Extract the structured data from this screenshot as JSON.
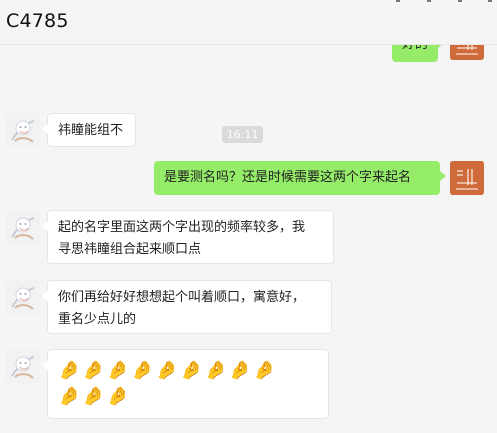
{
  "window": {
    "title": "C4785"
  },
  "partial_top_message": {
    "text": "好的"
  },
  "timestamp": "16:11",
  "messages": [
    {
      "side": "left",
      "text": "祎瞳能组不"
    },
    {
      "side": "right",
      "text": "是要测名吗？还是时候需要这两个字来起名"
    },
    {
      "side": "left",
      "text": "起的名字里面这两个字出现的频率较多，我\n寻思祎瞳组合起来顺口点"
    },
    {
      "side": "left",
      "text": "你们再给好好想想起个叫着顺口，寓意好，\n重名少点儿的"
    },
    {
      "side": "left",
      "text": "🤌🤌🤌🤌🤌🤌🤌🤌🤌\n🤌🤌🤌"
    }
  ],
  "avatars": {
    "self": {
      "color": "#cf6b3b"
    },
    "user": {
      "color": "#f2f2f2"
    }
  },
  "colors": {
    "background": "#f5f5f5",
    "self_bubble": "#95ec69",
    "other_bubble": "#ffffff"
  }
}
